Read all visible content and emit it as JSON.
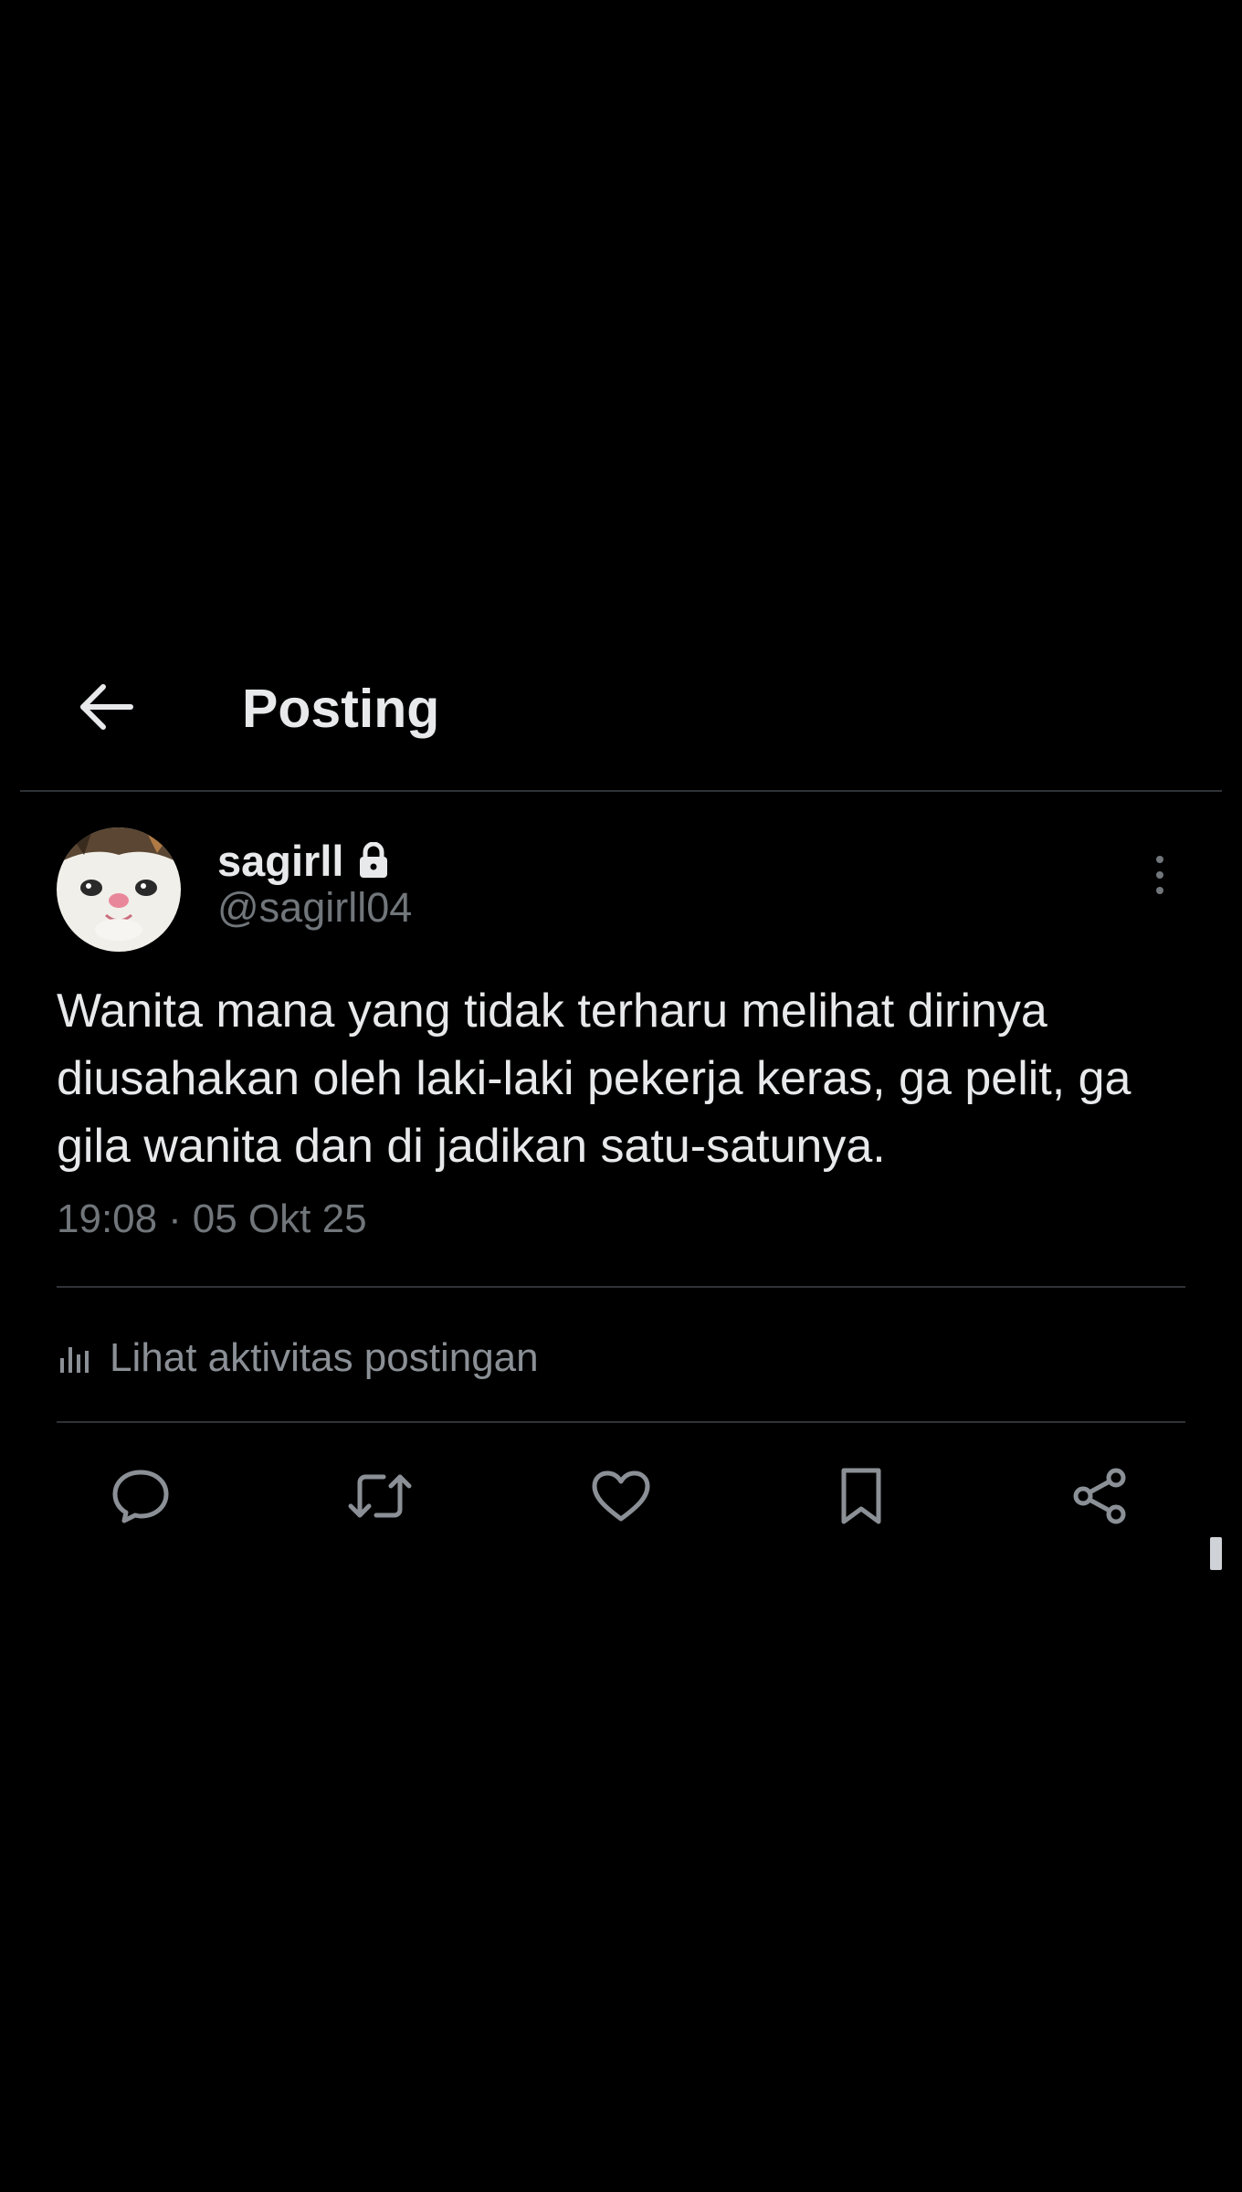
{
  "header": {
    "title": "Posting",
    "back_icon": "arrow-left-icon"
  },
  "post": {
    "author": {
      "display_name": "sagirll",
      "handle": "@sagirll04",
      "protected_icon": "lock-icon",
      "avatar_icon": "cat-avatar"
    },
    "text": "Wanita mana yang tidak terharu melihat dirinya diusahakan oleh laki-laki pekerja keras, ga pelit, ga gila wanita dan di jadikan satu-satunya.",
    "time": "19:08",
    "separator": "·",
    "date": "05 Okt 25",
    "more_icon": "more-vertical-icon"
  },
  "activity": {
    "label": "Lihat aktivitas postingan",
    "icon": "analytics-icon"
  },
  "actions": [
    {
      "name": "reply",
      "icon": "reply-icon"
    },
    {
      "name": "repost",
      "icon": "repost-icon"
    },
    {
      "name": "like",
      "icon": "heart-icon"
    },
    {
      "name": "bookmark",
      "icon": "bookmark-icon"
    },
    {
      "name": "share",
      "icon": "share-icon"
    }
  ],
  "colors": {
    "background": "#000000",
    "primary_text": "#e7e9ea",
    "secondary_text": "#71767b",
    "divider": "#2f3336"
  }
}
